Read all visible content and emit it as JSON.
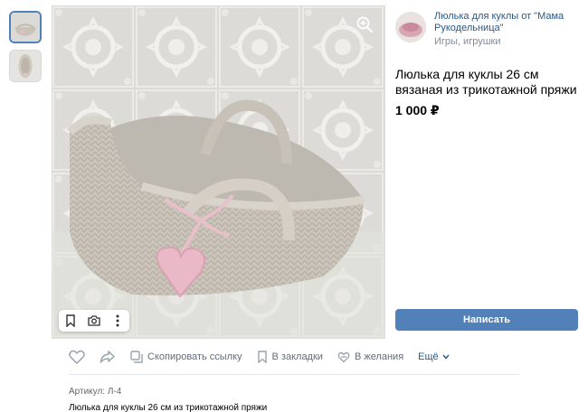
{
  "seller": {
    "name": "Люлька для куклы от \"Мама Рукодельница\"",
    "category": "Игры, игрушки"
  },
  "product": {
    "title": "Люлька для куклы 26 см вязаная из трикотажной пряжи",
    "price": "1 000 ₽",
    "article": "Артикул: Л-4",
    "description": "Люлька для куклы 26 см из трикотажной пряжи"
  },
  "buttons": {
    "write": "Написать"
  },
  "actions": {
    "copy_link": "Скопировать ссылку",
    "bookmarks": "В закладки",
    "wishlist": "В желания",
    "more": "Ещё"
  },
  "icons": {
    "zoom": "zoom-in-icon",
    "bookmark": "bookmark-icon",
    "camera": "camera-icon",
    "more": "dots-vertical-icon",
    "like": "heart-icon",
    "share": "share-arrow-icon",
    "copy": "copy-icon",
    "wish": "gift-icon",
    "chevron": "chevron-down-icon"
  },
  "colors": {
    "accent": "#5181b8",
    "link": "#2a5885",
    "muted": "#818c99"
  }
}
